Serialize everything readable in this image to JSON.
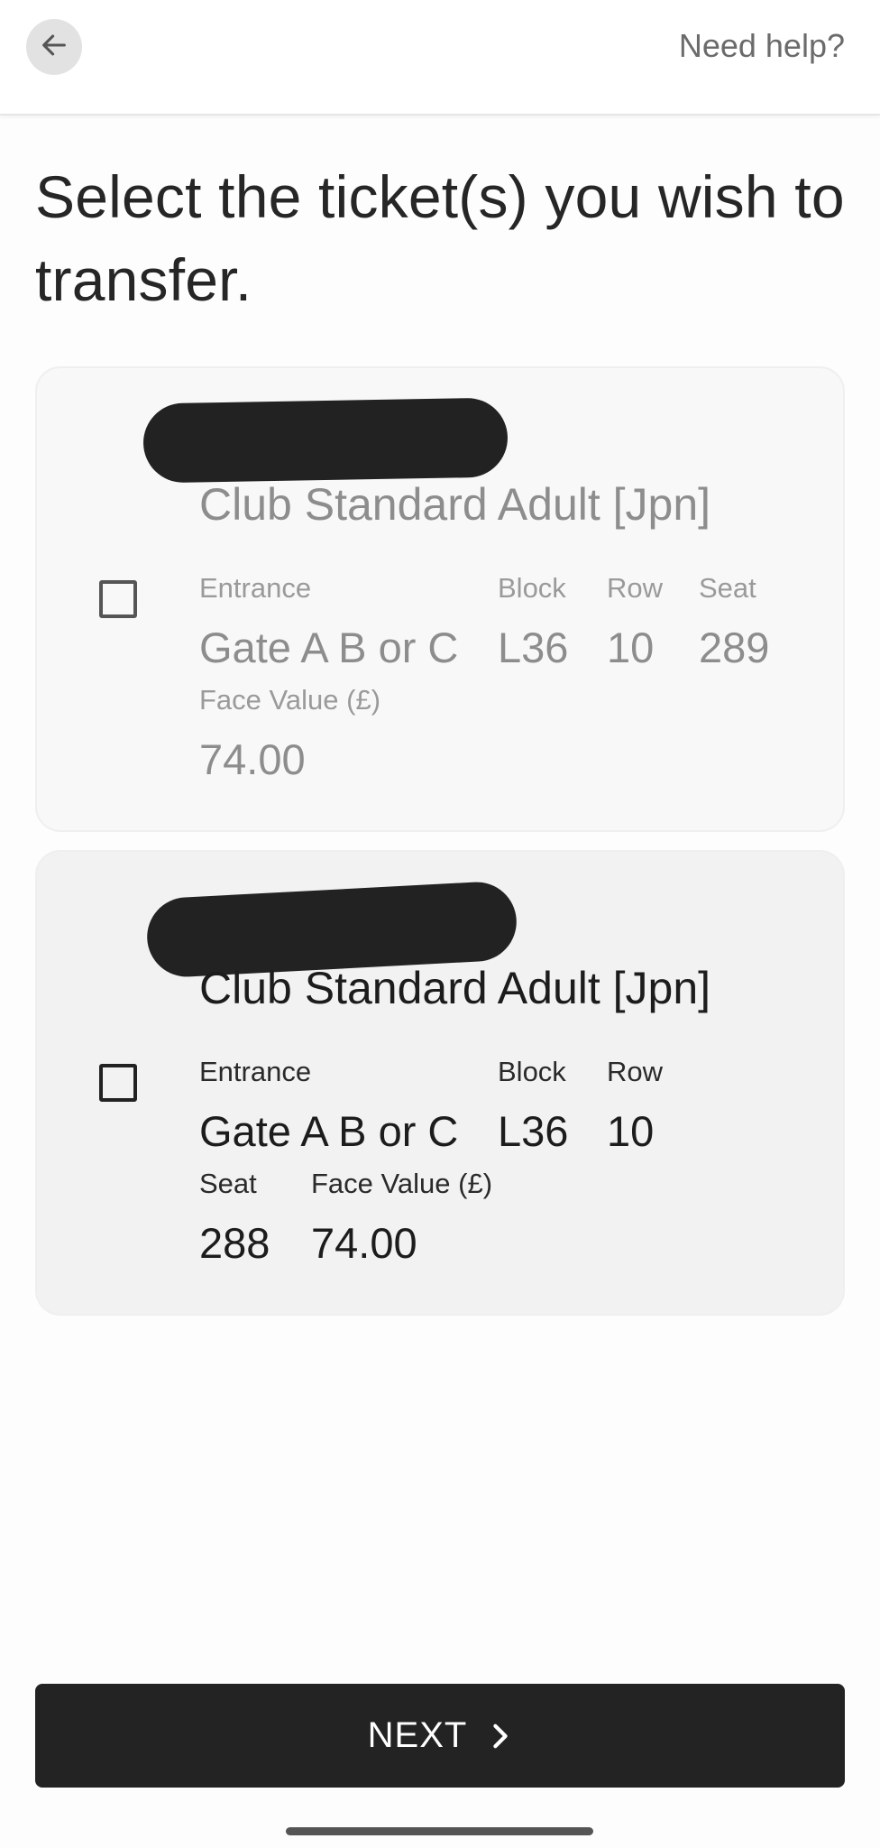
{
  "header": {
    "back_icon": "arrow-left-icon",
    "help_label": "Need help?"
  },
  "page": {
    "title": "Select the ticket(s) you wish to transfer."
  },
  "tickets": [
    {
      "name": "Club Standard Adult [Jpn]",
      "checked": false,
      "entrance_label": "Entrance",
      "entrance": "Gate A B or C",
      "block_label": "Block",
      "block": "L36",
      "row_label": "Row",
      "row": "10",
      "seat_label": "Seat",
      "seat": "289",
      "face_value_label": "Face Value (£)",
      "face_value": "74.00"
    },
    {
      "name": "Club Standard Adult [Jpn]",
      "checked": false,
      "entrance_label": "Entrance",
      "entrance": "Gate A B or C",
      "block_label": "Block",
      "block": "L36",
      "row_label": "Row",
      "row": "10",
      "seat_label": "Seat",
      "seat": "288",
      "face_value_label": "Face Value (£)",
      "face_value": "74.00"
    }
  ],
  "footer": {
    "next_label": "NEXT",
    "next_icon": "chevron-right-icon"
  },
  "colors": {
    "accent": "#232323",
    "muted_text": "#8d8d8d"
  }
}
